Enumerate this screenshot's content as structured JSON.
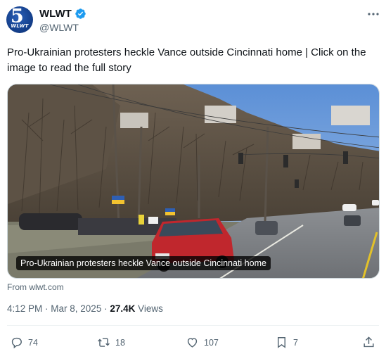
{
  "account": {
    "display_name": "WLWT",
    "handle": "@WLWT",
    "avatar_number": "5",
    "avatar_text": "WLWT"
  },
  "tweet": {
    "text": "Pro-Ukrainian protesters heckle Vance outside Cincinnati home | Click on the image to read the full story",
    "media_caption": "Pro-Ukrainian protesters heckle Vance outside Cincinnati home",
    "source": "From wlwt.com",
    "time": "4:12 PM",
    "date": "Mar 8, 2025",
    "separator": " · ",
    "views_count": "27.4K",
    "views_label": " Views"
  },
  "actions": {
    "replies": "74",
    "reposts": "18",
    "likes": "107",
    "bookmarks": "7"
  },
  "icons": [
    "verified-icon",
    "more-icon",
    "reply-icon",
    "repost-icon",
    "like-icon",
    "bookmark-icon",
    "share-icon"
  ],
  "colors": {
    "verified": "#1d9bf0",
    "secondary_text": "#536471",
    "primary_text": "#0f1419"
  }
}
